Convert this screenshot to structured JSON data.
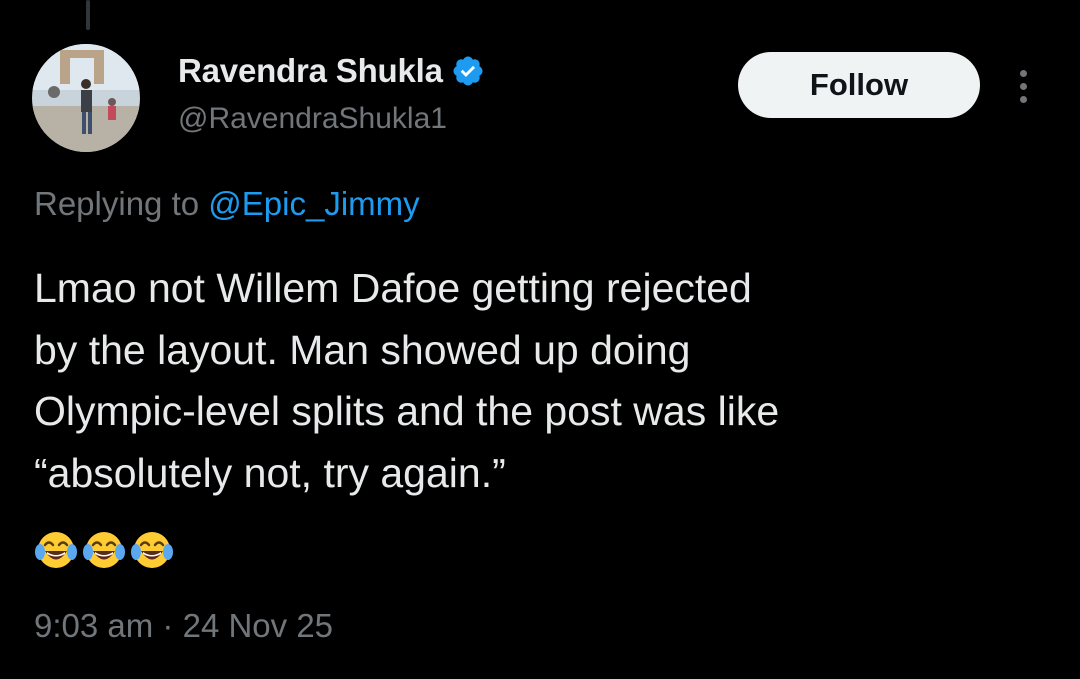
{
  "author": {
    "display_name": "Ravendra Shukla",
    "handle": "@RavendraShukla1",
    "verified": true
  },
  "actions": {
    "follow_label": "Follow",
    "more_icon": "more-vertical-icon"
  },
  "reply": {
    "prefix": "Replying to",
    "mention": "@Epic_Jimmy"
  },
  "tweet": {
    "lines": [
      "Lmao not Willem Dafoe getting rejected",
      "by the layout. Man showed up doing",
      "Olympic-level splits and the post was like",
      "“absolutely not, try again.”"
    ],
    "emojis": [
      "face-with-tears-of-joy-icon",
      "face-with-tears-of-joy-icon",
      "face-with-tears-of-joy-icon"
    ]
  },
  "meta": {
    "time": "9:03 am",
    "separator": "·",
    "date": "24 Nov 25"
  },
  "colors": {
    "background": "#000000",
    "text_primary": "#e7e9ea",
    "text_secondary": "#71767b",
    "accent": "#1d9bf0",
    "follow_bg": "#eff3f4"
  }
}
